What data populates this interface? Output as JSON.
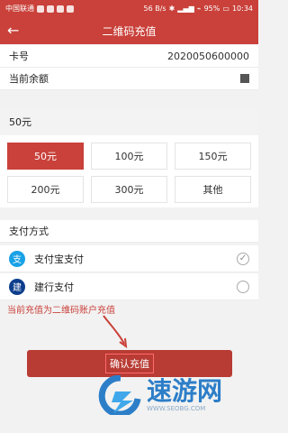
{
  "status_bar": {
    "carrier": "中国联通",
    "speed": "56 B/s",
    "battery": "95%",
    "time": "10:34"
  },
  "header": {
    "title": "二维码充值",
    "back_icon": "arrow-left-icon"
  },
  "card": {
    "label": "卡号",
    "value": "2020050600000"
  },
  "balance": {
    "label": "当前余额"
  },
  "selected_amount": "50元",
  "amount_options": [
    {
      "label": "50元",
      "selected": true
    },
    {
      "label": "100元",
      "selected": false
    },
    {
      "label": "150元",
      "selected": false
    },
    {
      "label": "200元",
      "selected": false
    },
    {
      "label": "300元",
      "selected": false
    },
    {
      "label": "其他",
      "selected": false
    }
  ],
  "payment": {
    "title": "支付方式",
    "methods": [
      {
        "label": "支付宝支付",
        "icon": "alipay-icon",
        "selected": true
      },
      {
        "label": "建行支付",
        "icon": "ccb-icon",
        "selected": false
      }
    ]
  },
  "note": "当前充值为二维码账户充值",
  "confirm_label": "确认充值",
  "watermark": {
    "brand": "速游网",
    "url": "WWW.SEOBG.COM"
  },
  "colors": {
    "primary": "#c9413a",
    "button": "#b83b34"
  }
}
